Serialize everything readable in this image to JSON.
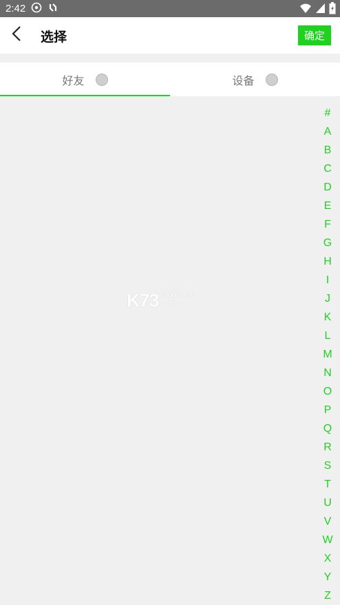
{
  "status_bar": {
    "time": "2:42",
    "icons": [
      "cast-icon",
      "sync-icon",
      "wifi-icon",
      "signal-icon",
      "battery-icon"
    ]
  },
  "header": {
    "title": "选择",
    "confirm_label": "确定",
    "back_icon": "chevron-left-icon"
  },
  "tabs": [
    {
      "label": "好友",
      "selected": true
    },
    {
      "label": "设备",
      "selected": false
    }
  ],
  "watermark": {
    "brand": "K73",
    "cn": "游戏之家",
    "domain": ".com"
  },
  "alpha_index": [
    "#",
    "A",
    "B",
    "C",
    "D",
    "E",
    "F",
    "G",
    "H",
    "I",
    "J",
    "K",
    "L",
    "M",
    "N",
    "O",
    "P",
    "Q",
    "R",
    "S",
    "T",
    "U",
    "V",
    "W",
    "X",
    "Y",
    "Z"
  ],
  "colors": {
    "accent": "#1ed31e",
    "status_bar": "#6b6b6b",
    "background": "#f0f0f0"
  }
}
